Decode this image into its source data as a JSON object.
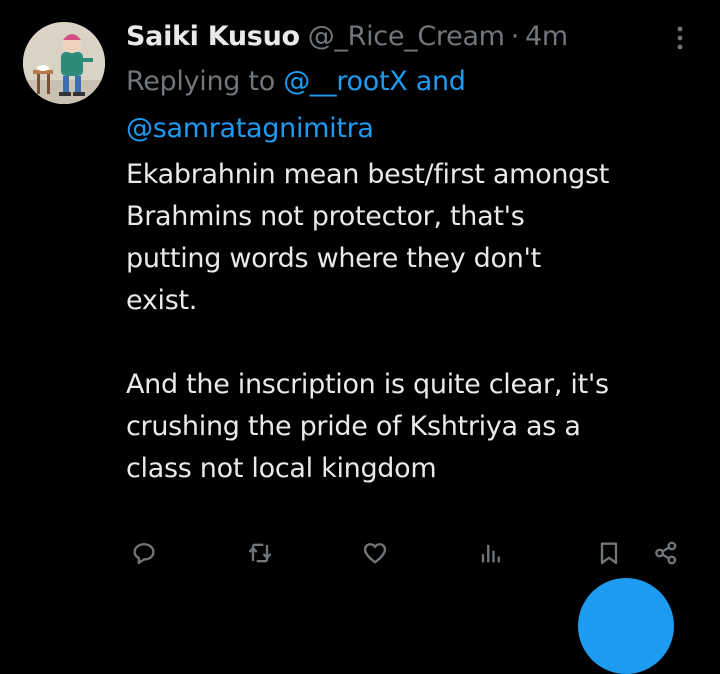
{
  "tweet": {
    "display_name": "Saiki Kusuo",
    "handle": "@_Rice_Cream",
    "separator": "·",
    "time": "4m",
    "replying_prefix": "Replying to",
    "mention_1": "@__rootX",
    "mention_joiner": "and",
    "mention_2": "@samratagnimitra",
    "paragraph_1_lines": [
      "Ekabrahnin mean best/first amongst",
      "Brahmins not protector, that's",
      "putting words where they don't",
      "exist."
    ],
    "paragraph_2_lines": [
      "And the inscription is quite clear, it's",
      "crushing the pride of Kshtriya as a",
      "class not local kingdom"
    ]
  },
  "actions": [
    {
      "name": "reply",
      "icon": "comment-icon"
    },
    {
      "name": "retweet",
      "icon": "retweet-icon"
    },
    {
      "name": "like",
      "icon": "heart-icon"
    },
    {
      "name": "views",
      "icon": "bar-chart-icon"
    },
    {
      "name": "bookmark",
      "icon": "bookmark-icon"
    },
    {
      "name": "share",
      "icon": "share-icon"
    }
  ],
  "colors": {
    "background": "#000000",
    "text_primary": "#e7e9ea",
    "text_secondary": "#71767b",
    "accent": "#1d9bf0"
  }
}
